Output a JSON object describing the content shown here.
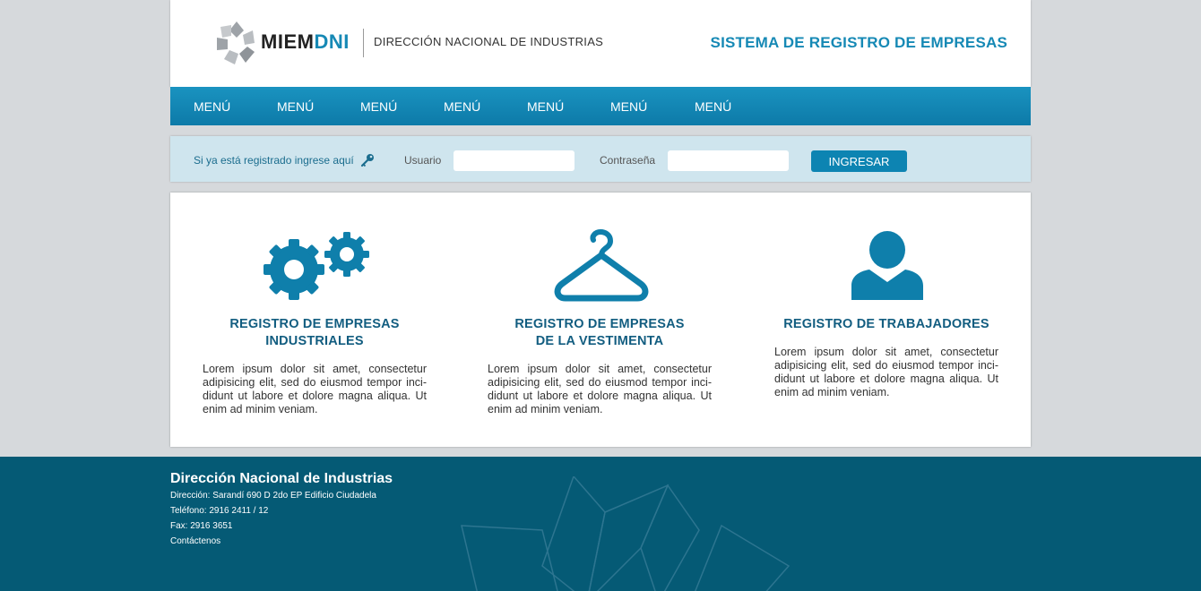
{
  "header": {
    "logo_text_a": "MIEM",
    "logo_text_b": "DNI",
    "logo_subtitle": "DIRECCIÓN NACIONAL DE INDUSTRIAS",
    "system_title": "SISTEMA DE REGISTRO DE EMPRESAS"
  },
  "nav": {
    "items": [
      {
        "label": "MENÚ"
      },
      {
        "label": "MENÚ"
      },
      {
        "label": "MENÚ"
      },
      {
        "label": "MENÚ"
      },
      {
        "label": "MENÚ"
      },
      {
        "label": "MENÚ"
      },
      {
        "label": "MENÚ"
      }
    ]
  },
  "login": {
    "prompt": "Si ya está registrado ingrese aquí",
    "user_label": "Usuario",
    "user_value": "",
    "password_label": "Contraseña",
    "password_value": "",
    "submit_label": "INGRESAR",
    "icon": "key-icon"
  },
  "cards": [
    {
      "icon": "gears-icon",
      "title_line1": "REGISTRO DE EMPRESAS",
      "title_line2": "INDUSTRIALES",
      "text": "Lorem ipsum dolor sit amet, consectetur adipisicing elit, sed do eiusmod tempor inci-didunt ut labore et dolore magna aliqua. Ut enim ad minim veniam."
    },
    {
      "icon": "hanger-icon",
      "title_line1": "REGISTRO DE EMPRESAS",
      "title_line2": "DE LA VESTIMENTA",
      "text": "Lorem ipsum dolor sit amet, consectetur adipisicing elit, sed do eiusmod tempor inci-didunt ut labore et dolore magna aliqua. Ut enim ad minim veniam."
    },
    {
      "icon": "user-icon",
      "title_line1": "REGISTRO DE TRABAJADORES",
      "text": "Lorem ipsum dolor sit amet, consectetur adipisicing elit, sed do eiusmod tempor inci-didunt ut labore et dolore magna aliqua. Ut enim ad minim veniam."
    }
  ],
  "footer": {
    "title": "Dirección Nacional de Industrias",
    "address": "Dirección: Sarandí 690 D 2do EP Edificio Ciudadela",
    "phone": "Teléfono: 2916 2411 / 12",
    "fax": "Fax: 2916 3651",
    "contact": "Contáctenos"
  },
  "colors": {
    "brand": "#1689b5",
    "nav": "#0d7aa8",
    "login_bg": "#cfe5ee",
    "footer_bg": "#055a75",
    "page_bg": "#d6d9dc"
  }
}
